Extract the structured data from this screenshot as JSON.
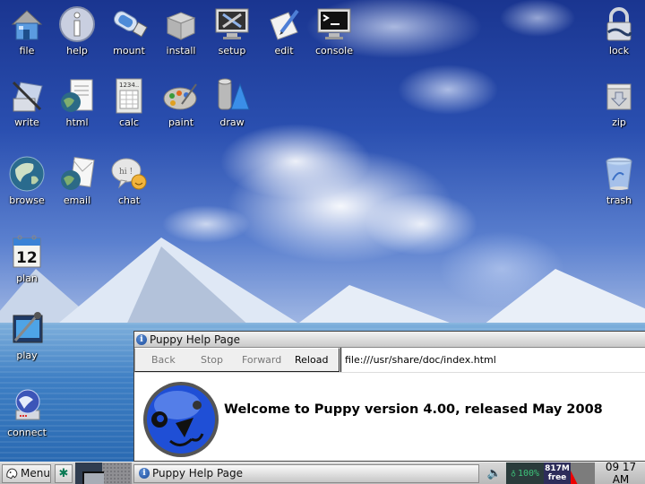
{
  "desktop": {
    "icons": [
      {
        "id": "file",
        "label": "file",
        "icon": "home-icon"
      },
      {
        "id": "help",
        "label": "help",
        "icon": "info-icon"
      },
      {
        "id": "mount",
        "label": "mount",
        "icon": "usb-drive-icon"
      },
      {
        "id": "install",
        "label": "install",
        "icon": "package-box-icon"
      },
      {
        "id": "setup",
        "label": "setup",
        "icon": "tools-monitor-icon"
      },
      {
        "id": "edit",
        "label": "edit",
        "icon": "pen-paper-icon"
      },
      {
        "id": "console",
        "label": "console",
        "icon": "terminal-icon"
      },
      {
        "id": "write",
        "label": "write",
        "icon": "word-processor-icon"
      },
      {
        "id": "html",
        "label": "html",
        "icon": "web-document-icon"
      },
      {
        "id": "calc",
        "label": "calc",
        "icon": "spreadsheet-icon"
      },
      {
        "id": "paint",
        "label": "paint",
        "icon": "palette-icon"
      },
      {
        "id": "draw",
        "label": "draw",
        "icon": "shapes-icon"
      },
      {
        "id": "browse",
        "label": "browse",
        "icon": "globe-icon"
      },
      {
        "id": "email",
        "label": "email",
        "icon": "envelope-globe-icon"
      },
      {
        "id": "chat",
        "label": "chat",
        "icon": "chat-bubble-icon"
      },
      {
        "id": "plan",
        "label": "plan",
        "icon": "calendar-icon",
        "text": "12"
      },
      {
        "id": "play",
        "label": "play",
        "icon": "media-player-icon"
      },
      {
        "id": "connect",
        "label": "connect",
        "icon": "network-connect-icon"
      },
      {
        "id": "lock",
        "label": "lock",
        "icon": "padlock-icon"
      },
      {
        "id": "zip",
        "label": "zip",
        "icon": "archive-icon"
      },
      {
        "id": "trash",
        "label": "trash",
        "icon": "trash-can-icon"
      }
    ]
  },
  "browser": {
    "title": "Puppy Help Page",
    "title_icon": "i",
    "nav": {
      "back": "Back",
      "stop": "Stop",
      "forward": "Forward",
      "reload": "Reload"
    },
    "url": "file:///usr/share/doc/index.html",
    "heading": "Welcome to Puppy version 4.00, released May 2008"
  },
  "taskbar": {
    "menu_label": "Menu",
    "quick_launch_icon": "✱",
    "task_title": "Puppy Help Page",
    "battery": "100%",
    "memory_value": "817M",
    "memory_label": "free",
    "clock": "09 17 AM",
    "colors": {
      "battery_text": "#3ec27a",
      "cpu_bar": "#e00000"
    }
  }
}
